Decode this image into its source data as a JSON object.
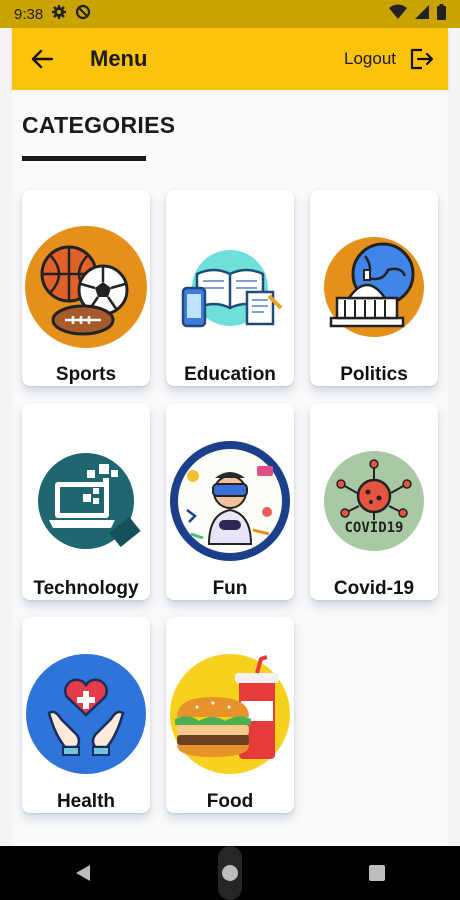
{
  "status_bar": {
    "time": "9:38"
  },
  "app_bar": {
    "title": "Menu",
    "logout_label": "Logout"
  },
  "page": {
    "heading": "CATEGORIES"
  },
  "categories": [
    {
      "label": "Sports",
      "icon": "sports-balls-icon"
    },
    {
      "label": "Education",
      "icon": "books-icon"
    },
    {
      "label": "Politics",
      "icon": "capitol-globe-icon"
    },
    {
      "label": "Technology",
      "icon": "laptop-icon"
    },
    {
      "label": "Fun",
      "icon": "vr-gamer-icon"
    },
    {
      "label": "Covid-19",
      "icon": "covid-virus-icon"
    },
    {
      "label": "Health",
      "icon": "heart-hands-icon"
    },
    {
      "label": "Food",
      "icon": "burger-drink-icon"
    }
  ],
  "colors": {
    "app_bar": "#fcc30d",
    "status_bar": "#c9a400",
    "nav_bar": "#000000"
  }
}
